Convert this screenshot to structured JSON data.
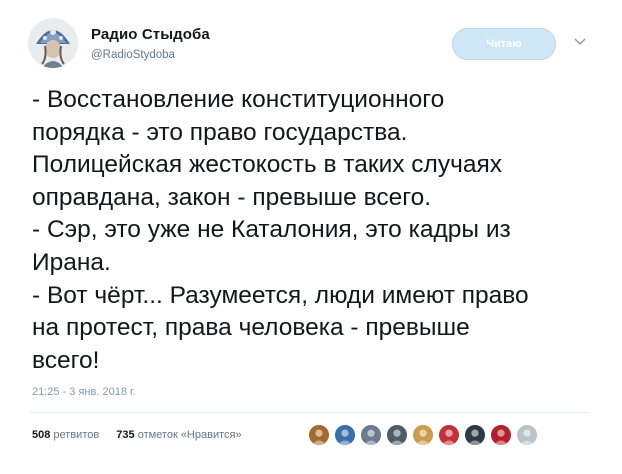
{
  "header": {
    "display_name": "Радио Стыдоба",
    "handle": "@RadioStydoba",
    "follow_label": "Читаю"
  },
  "tweet": {
    "lines": [
      "- Восстановление конституционного",
      "порядка - это право государства.",
      "Полицейская жестокость в таких случаях",
      "оправдана, закон - превыше всего.",
      "- Сэр, это уже не Каталония, это кадры из",
      "Ирана.",
      "- Вот чёрт... Разумеется, люди имеют право",
      "на протест, права человека - превыше",
      "всего!"
    ],
    "timestamp": "21:25 - 3 янв. 2018 г."
  },
  "stats": {
    "retweets_count": "508",
    "retweets_label": "ретвитов",
    "likes_count": "735",
    "likes_label": "отметок «Нравится»"
  },
  "likers": [
    {
      "icon": "avatar-dog-icon",
      "color": "#a5692e"
    },
    {
      "icon": "avatar-tower-icon",
      "color": "#3c6ea8"
    },
    {
      "icon": "avatar-person-icon",
      "color": "#6b7a8f"
    },
    {
      "icon": "avatar-person-icon",
      "color": "#4d5d66"
    },
    {
      "icon": "avatar-person-icon",
      "color": "#c99b4e"
    },
    {
      "icon": "avatar-person-icon",
      "color": "#c3323a"
    },
    {
      "icon": "avatar-person-icon",
      "color": "#2f3a48"
    },
    {
      "icon": "avatar-pirate-icon",
      "color": "#b2202a"
    },
    {
      "icon": "avatar-placeholder-icon",
      "color": "#b8c4cc"
    }
  ],
  "colors": {
    "text": "#14171a",
    "secondary": "#657786",
    "follow_bg": "#cfe6f6"
  }
}
